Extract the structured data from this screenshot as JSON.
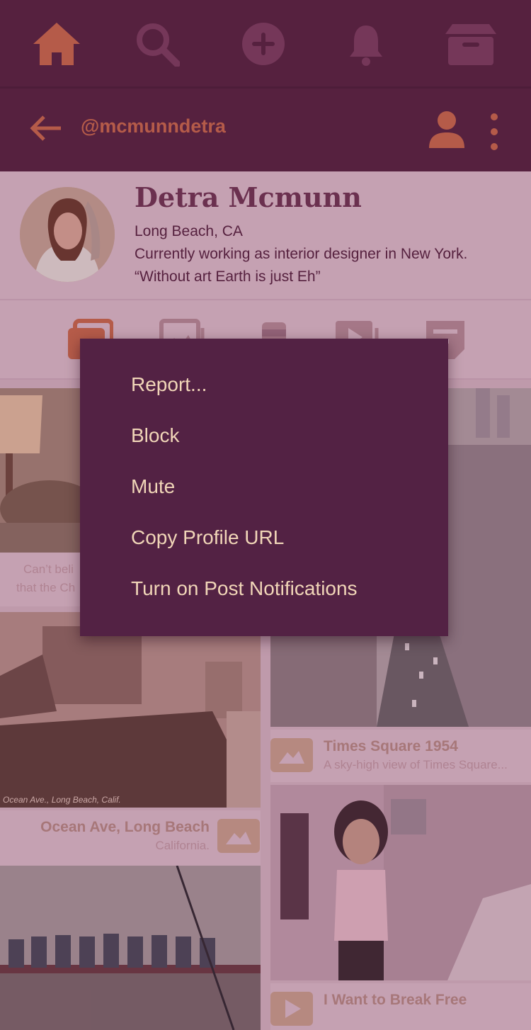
{
  "top_nav": {
    "items": [
      "home-icon",
      "search-icon",
      "add-icon",
      "bell-icon",
      "archive-icon"
    ],
    "accent_color": "#c86a4b",
    "idle_color": "#7a3d5f"
  },
  "header": {
    "back_icon": "arrow-left-icon",
    "username": "@mcmunndetra",
    "follow_icon": "person-icon",
    "more_icon": "more-vert-icon"
  },
  "profile": {
    "name": "Detra Mcmunn",
    "location": "Long Beach, CA",
    "bio_line1": "Currently working as interior designer in New York.",
    "bio_line2": "“Without art Earth is just Eh”"
  },
  "content_tabs": [
    "gallery-icon",
    "photos-icon",
    "minimize-icon",
    "video-icon",
    "text-icon"
  ],
  "feed": {
    "tile1_caption_line1": "Can’t beli",
    "tile1_caption_line2": "that the Ch",
    "tile3_title": "Ocean Ave, Long Beach",
    "tile3_subtitle": "California.",
    "tile3_photo_text": "Ocean Ave., Long Beach, Calif.",
    "tile2_title": "Times Square 1954",
    "tile2_subtitle": "A sky-high view of Times Square...",
    "tile4_title": "I Want to Break Free"
  },
  "context_menu": {
    "items": [
      "Report...",
      "Block",
      "Mute",
      "Copy Profile URL",
      "Turn on Post Notifications"
    ]
  }
}
